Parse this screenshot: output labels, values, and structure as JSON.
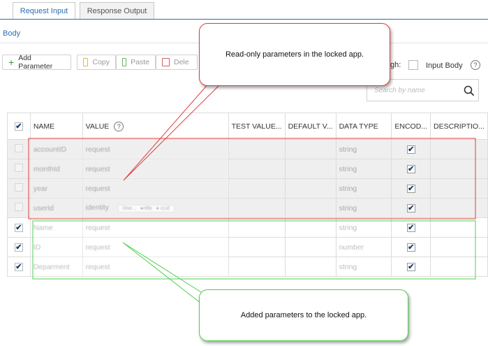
{
  "tabs": {
    "request": "Request Input",
    "response": "Response Output"
  },
  "body_label": "Body",
  "toolbar": {
    "add": "Add Parameter",
    "copy": "Copy",
    "paste": "Paste",
    "delete": "Dele"
  },
  "passthrough_label": "gh:",
  "input_body_label": "Input Body",
  "help_glyph": "?",
  "search_placeholder": "Search by name",
  "table": {
    "headers": {
      "name": "NAME",
      "value": "VALUE",
      "test": "TEST VALUE...",
      "default": "DEFAULT V...",
      "dtype": "DATA TYPE",
      "enc": "ENCOD...",
      "desc": "DESCRIPTIO..."
    },
    "rows": [
      {
        "name": "accountID",
        "value": "request",
        "dtype": "string"
      },
      {
        "name": "monthId",
        "value": "request",
        "dtype": "string"
      },
      {
        "name": "year",
        "value": "request",
        "dtype": "string"
      },
      {
        "name": "userId",
        "value": "identity",
        "dtype": "string"
      },
      {
        "name": "Name",
        "value": "request",
        "dtype": "string"
      },
      {
        "name": "ID",
        "value": "request",
        "dtype": "number"
      },
      {
        "name": "Deparment",
        "value": "request",
        "dtype": "string"
      }
    ],
    "identity_options": [
      "0Ise...",
      "●nfile",
      "● cLid"
    ]
  },
  "callouts": {
    "top": "Read-only parameters in the locked app.",
    "bottom": "Added parameters to the locked app."
  },
  "colors": {
    "accent": "#2a6fb0",
    "callout_red": "#e23a3a",
    "callout_green": "#4ccf4c"
  }
}
